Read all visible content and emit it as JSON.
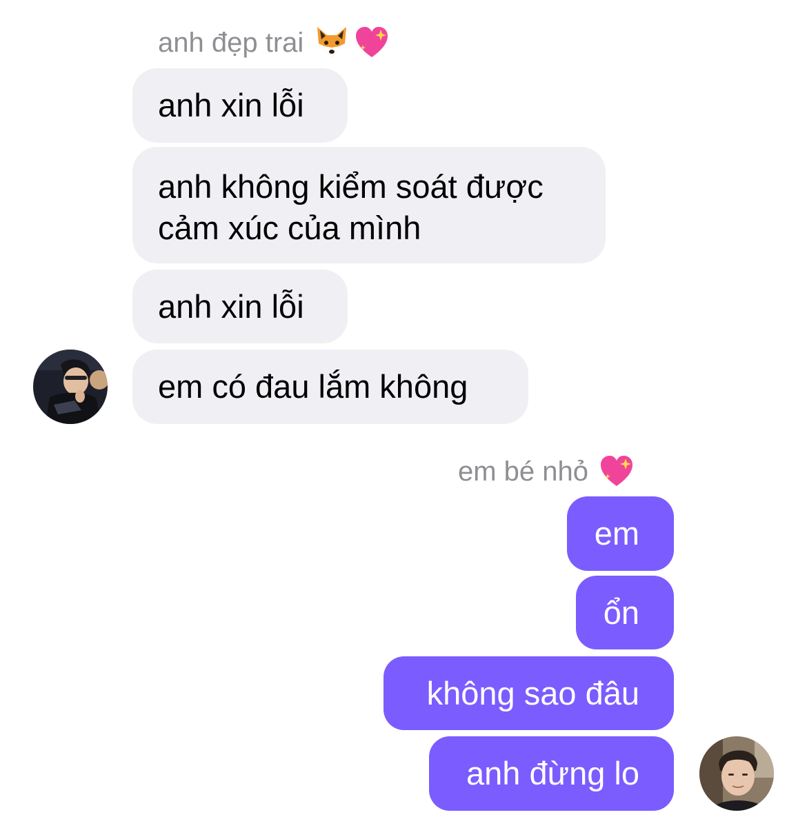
{
  "incoming": {
    "sender_name": "anh đẹp trai",
    "sender_emojis": [
      "fox-face-emoji",
      "sparkling-heart-emoji"
    ],
    "messages": [
      "anh xin lỗi",
      "anh không kiểm soát được",
      "cảm xúc của mình",
      "anh xin lỗi",
      "em có đau lắm không"
    ],
    "bubble_color": "#efeff4",
    "text_color": "#000000"
  },
  "outgoing": {
    "sender_name": "em bé nhỏ",
    "sender_emojis": [
      "sparkling-heart-emoji"
    ],
    "messages": [
      "em",
      "ổn",
      "không sao đâu",
      "anh đừng lo"
    ],
    "bubble_color": "#7b5cff",
    "text_color": "#ffffff"
  },
  "colors": {
    "name_gray": "#8e8e93",
    "background": "#ffffff"
  }
}
